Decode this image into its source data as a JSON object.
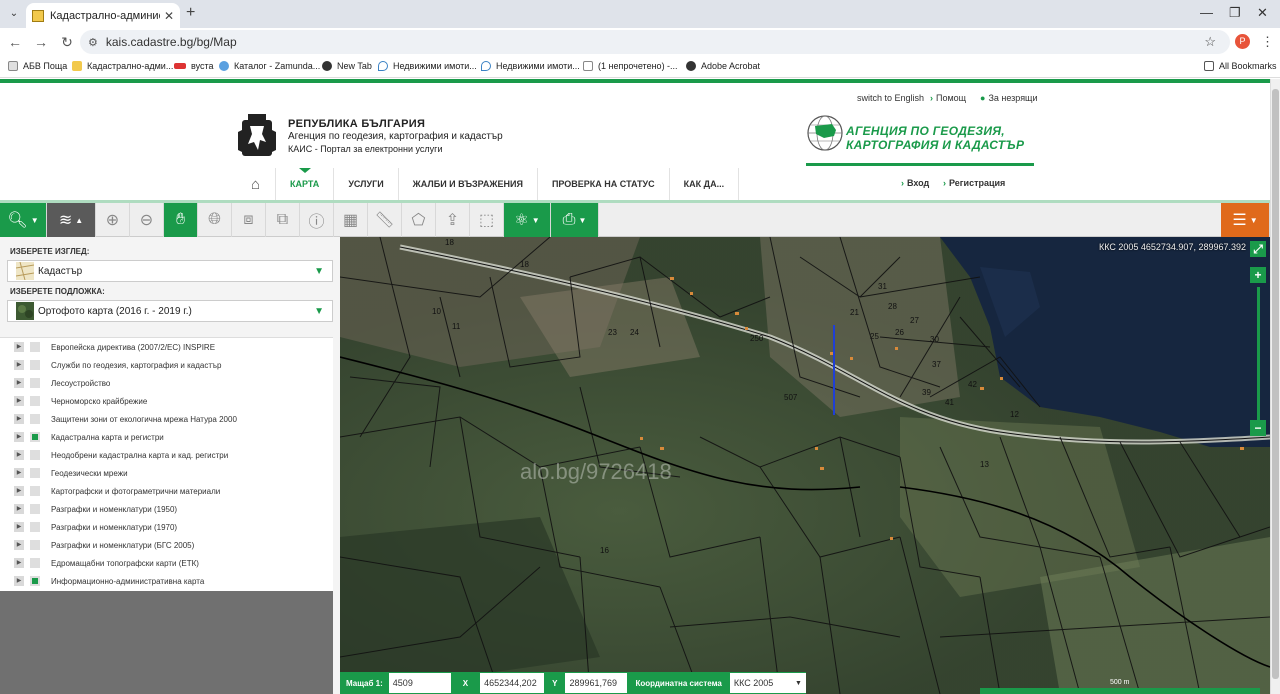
{
  "browser": {
    "tab_title": "Кадастрално-административн...",
    "url": "kais.cadastre.bg/bg/Map",
    "profile_initial": "P",
    "bookmarks": [
      "АБВ Поща",
      "Кадастрално-адми...",
      "вуста",
      "Каталог - Zamunda...",
      "New Tab",
      "Недвижими имоти...",
      "Недвижими имоти...",
      "(1 непрочетено) -...",
      "Adobe Acrobat"
    ],
    "all_bookmarks": "All Bookmarks"
  },
  "header": {
    "switch_lang": "switch to English",
    "help": "Помощ",
    "accessibility": "За незрящи",
    "republic": "РЕПУБЛИКА БЪЛГАРИЯ",
    "agency_line": "Агенция по геодезия, картография и кадастър",
    "portal_line": "КАИС - Портал за електронни услуги",
    "agency_logo_line1": "АГЕНЦИЯ ПО ГЕОДЕЗИЯ,",
    "agency_logo_line2": "КАРТОГРАФИЯ И КАДАСТЪР"
  },
  "nav": {
    "items": [
      "КАРТА",
      "УСЛУГИ",
      "ЖАЛБИ И ВЪЗРАЖЕНИЯ",
      "ПРОВЕРКА НА СТАТУС",
      "КАК ДА..."
    ],
    "login": "Вход",
    "register": "Регистрация"
  },
  "sidebar": {
    "view_label": "ИЗБЕРЕТЕ ИЗГЛЕД:",
    "view_value": "Кадастър",
    "base_label": "ИЗБЕРЕТЕ ПОДЛОЖКА:",
    "base_value": "Ортофото карта (2016 г. - 2019 г.)",
    "layers": [
      {
        "name": "Европейска директива (2007/2/ЕС) INSPIRE",
        "checked": false
      },
      {
        "name": "Служби по геодезия, картография и кадастър",
        "checked": false
      },
      {
        "name": "Лесоустройство",
        "checked": false
      },
      {
        "name": "Черноморско крайбрежие",
        "checked": false
      },
      {
        "name": "Защитени зони от екологична мрежа Натура 2000",
        "checked": false
      },
      {
        "name": "Кадастрална карта и регистри",
        "checked": true
      },
      {
        "name": "Неодобрени кадастрална карта и кад. регистри",
        "checked": false
      },
      {
        "name": "Геодезически мрежи",
        "checked": false
      },
      {
        "name": "Картографски и фотограметрични материали",
        "checked": false
      },
      {
        "name": "Разграфки и номенклатури (1950)",
        "checked": false
      },
      {
        "name": "Разграфки и номенклатури (1970)",
        "checked": false
      },
      {
        "name": "Разграфки и номенклатури (БГС 2005)",
        "checked": false
      },
      {
        "name": "Едромащабни топографски карти (ЕТК)",
        "checked": false
      },
      {
        "name": "Информационно-административна карта",
        "checked": true
      }
    ]
  },
  "map": {
    "coords_top": "ККС 2005 4652734.907, 289967.392",
    "watermark": "alo.bg/9726418",
    "scale_bar_label": "500 m",
    "parcel_labels": [
      "18",
      "18",
      "10",
      "11",
      "24",
      "23",
      "21",
      "25",
      "26",
      "27",
      "30",
      "37",
      "39",
      "41",
      "42",
      "12",
      "507",
      "250",
      "13",
      "16",
      "31",
      "28"
    ]
  },
  "status": {
    "scale_label": "Мащаб 1:",
    "scale_value": "4509",
    "x_label": "X",
    "x_value": "4652344,202",
    "y_label": "Y",
    "y_value": "289961,769",
    "cs_label": "Координатна система",
    "cs_value": "ККС 2005"
  },
  "colors": {
    "accent": "#1a9a4a",
    "orange": "#e06a1b"
  }
}
